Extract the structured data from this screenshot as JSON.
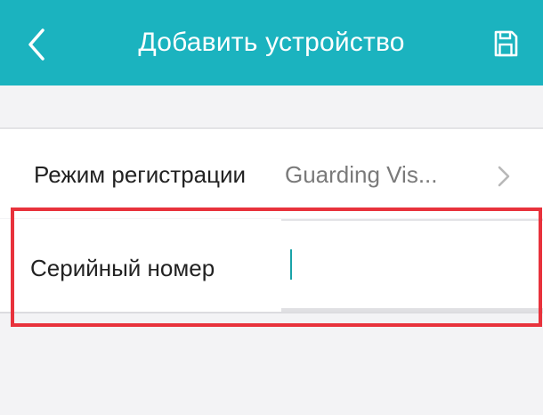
{
  "header": {
    "title": "Добавить устройство",
    "back_icon": "chevron-left-icon",
    "save_icon": "save-icon",
    "background_color": "#1bb3bf"
  },
  "form": {
    "registration_mode": {
      "label": "Режим регистрации",
      "value": "Guarding Vis...",
      "icon": "chevron-right-icon"
    },
    "serial_number": {
      "label": "Серийный номер",
      "value": ""
    }
  },
  "highlight": {
    "color": "#e8323c"
  }
}
